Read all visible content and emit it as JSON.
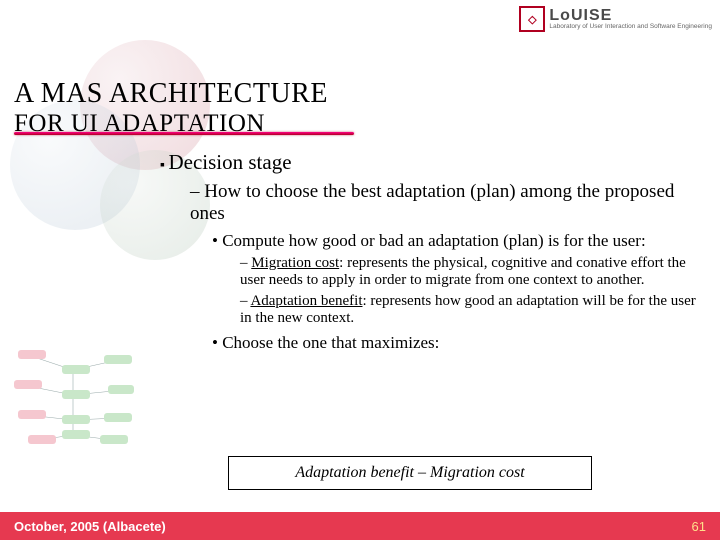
{
  "logo": {
    "mark_text": "◇",
    "name": "LoUISE",
    "tagline": "Laboratory of User Interaction\nand Software Engineering"
  },
  "title": {
    "line1": "A MAS ARCHITECTURE",
    "line2": "FOR UI ADAPTATION"
  },
  "content": {
    "lvl1": "Decision stage",
    "lvl2": "How to choose the best adaptation (plan) among the proposed ones",
    "lvl3a": "Compute how good or bad an adaptation (plan) is for the user:",
    "lvl4a_label": "Migration cost",
    "lvl4a_rest": ": represents the physical, cognitive and conative effort the user needs to apply in order to migrate from one context to another.",
    "lvl4b_label": "Adaptation benefit",
    "lvl4b_rest": ": represents how good an adaptation will be for the user in the new context.",
    "lvl3b": "Choose the one that maximizes:"
  },
  "formula": "Adaptation benefit – Migration cost",
  "footer": {
    "left": "October, 2005 (Albacete)",
    "page": "61"
  }
}
